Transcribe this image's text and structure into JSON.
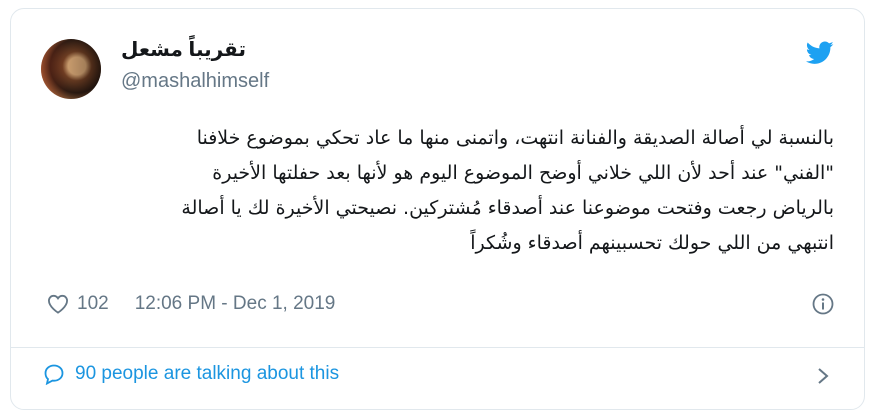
{
  "tweet": {
    "author": {
      "display_name": "تقريباً مشعل",
      "handle": "@mashalhimself"
    },
    "text_lines": [
      "بالنسبة لي أصالة الصديقة والفنانة انتهت، واتمنى منها ما عاد تحكي بموضوع خلافنا",
      "\"الفني\" عند أحد لأن اللي خلاني أوضح الموضوع اليوم هو لأنها بعد حفلتها الأخيرة",
      "بالرياض رجعت وفتحت موضوعنا عند أصدقاء مُشتركين. نصيحتي الأخيرة لك يا أصالة",
      "انتبهي من اللي حولك تحسبينهم أصدقاء وشُكراً"
    ],
    "like_count": "102",
    "timestamp": "12:06 PM - Dec 1, 2019",
    "conversation_text": "90 people are talking about this"
  },
  "icons": {
    "brand": "twitter-bird-icon",
    "like": "heart-icon",
    "info": "info-icon",
    "conversation": "speech-bubble-icon",
    "more": "chevron-right-icon"
  },
  "colors": {
    "twitter_blue": "#1da1f2",
    "link_blue": "#1b95e0",
    "secondary_text": "#657786",
    "border": "#e1e8ed"
  }
}
